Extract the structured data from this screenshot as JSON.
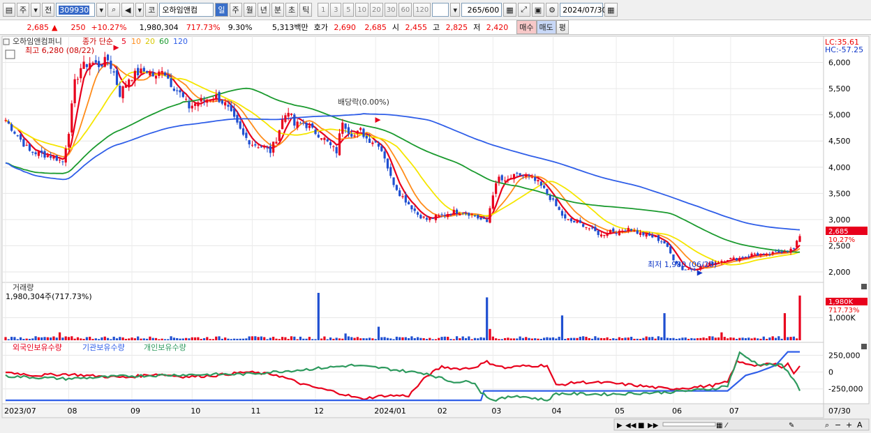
{
  "toolbar": {
    "type1": "주",
    "type2": "전",
    "code": "309930",
    "stock_name": "오하임앤컴",
    "periods": [
      "일",
      "주",
      "월",
      "년",
      "분",
      "초",
      "틱"
    ],
    "active_period": "일",
    "minutes": [
      "1",
      "3",
      "5",
      "10",
      "20",
      "30",
      "60",
      "120"
    ],
    "count": "265",
    "count_max": "/600",
    "date": "2024/07/30"
  },
  "quote": {
    "price": "2,685",
    "arrow": "▲",
    "change": "250",
    "change_pct": "+10.27%",
    "volume": "1,980,304",
    "volume_ratio": "717.73%",
    "turnover": "9.30%",
    "amount": "5,313백만",
    "bid_label": "호가",
    "ask": "2,690",
    "bid": "2,685",
    "open_label": "시",
    "open": "2,455",
    "high_label": "고",
    "high": "2,825",
    "low_label": "저",
    "low": "2,420",
    "buy_label": "매수",
    "sell_label": "매도",
    "flat_label": "평"
  },
  "price_panel": {
    "name": "오하임앤컴퍼니",
    "ma_label": "종가 단순",
    "ma_periods": [
      "5",
      "10",
      "20",
      "60",
      "120"
    ],
    "max_label": "최고 6,280 (08/22)",
    "min_label": "최저 1,980 (06/28)",
    "dividend_label": "배당락(0.00%)",
    "lc_label": "LC:35.61",
    "hc_label": "HC:-57.25",
    "current_price": "2,685",
    "current_pct": "10.27%"
  },
  "volume_panel": {
    "title": "거래량",
    "value_label": "1,980,304주(717.73%)",
    "current": "1,980K",
    "current_pct": "717.73%"
  },
  "holding_panel": {
    "legend": [
      "외국인보유수량",
      "기관보유수량",
      "개인보유수량"
    ]
  },
  "x_axis": {
    "months": [
      "2023/07",
      "08",
      "09",
      "10",
      "11",
      "12",
      "2024/01",
      "02",
      "03",
      "04",
      "05",
      "06",
      "07"
    ],
    "last_date": "07/30"
  },
  "colors": {
    "ma5": "#e8001c",
    "ma10": "#ff8c1a",
    "ma20": "#f5e600",
    "ma60": "#1a9a2e",
    "ma120": "#2f5ee8",
    "up": "#e8001c",
    "down": "#1f4fd1",
    "foreign": "#e8001c",
    "inst": "#2f5ee8",
    "indiv": "#2e9a5e"
  },
  "chart_data": [
    {
      "type": "line",
      "title": "오하임앤컴퍼니",
      "subtitle": "종가 단순",
      "ylim": [
        1800,
        6500
      ],
      "yticks": [
        2000,
        2500,
        3000,
        3500,
        4000,
        4500,
        5000,
        5500,
        6000
      ],
      "months": [
        {
          "label": "2023/07",
          "i": 0
        },
        {
          "label": "08",
          "i": 21
        },
        {
          "label": "09",
          "i": 42
        },
        {
          "label": "10",
          "i": 62
        },
        {
          "label": "11",
          "i": 82
        },
        {
          "label": "12",
          "i": 103
        },
        {
          "label": "2024/01",
          "i": 123
        },
        {
          "label": "02",
          "i": 144
        },
        {
          "label": "03",
          "i": 162
        },
        {
          "label": "04",
          "i": 182
        },
        {
          "label": "05",
          "i": 203
        },
        {
          "label": "06",
          "i": 222
        },
        {
          "label": "07",
          "i": 241
        }
      ],
      "close_anchors": [
        [
          0,
          4900
        ],
        [
          4,
          4600
        ],
        [
          8,
          4300
        ],
        [
          12,
          4250
        ],
        [
          16,
          4200
        ],
        [
          19,
          4100
        ],
        [
          21,
          4700
        ],
        [
          23,
          5600
        ],
        [
          25,
          5900
        ],
        [
          28,
          6000
        ],
        [
          31,
          5950
        ],
        [
          34,
          6050
        ],
        [
          36,
          5800
        ],
        [
          38,
          5400
        ],
        [
          41,
          5700
        ],
        [
          44,
          5800
        ],
        [
          47,
          5850
        ],
        [
          50,
          5700
        ],
        [
          52,
          5900
        ],
        [
          55,
          5600
        ],
        [
          58,
          5400
        ],
        [
          61,
          5150
        ],
        [
          64,
          5250
        ],
        [
          67,
          5300
        ],
        [
          70,
          5350
        ],
        [
          73,
          5200
        ],
        [
          76,
          4900
        ],
        [
          79,
          4600
        ],
        [
          82,
          4450
        ],
        [
          85,
          4400
        ],
        [
          88,
          4300
        ],
        [
          90,
          4550
        ],
        [
          92,
          4900
        ],
        [
          94,
          5100
        ],
        [
          96,
          4800
        ],
        [
          99,
          4850
        ],
        [
          102,
          4700
        ],
        [
          105,
          4600
        ],
        [
          108,
          4400
        ],
        [
          110,
          4300
        ],
        [
          112,
          4900
        ],
        [
          114,
          4700
        ],
        [
          116,
          4600
        ],
        [
          118,
          4700
        ],
        [
          120,
          4550
        ],
        [
          122,
          4500
        ],
        [
          124,
          4450
        ],
        [
          126,
          4200
        ],
        [
          128,
          3800
        ],
        [
          131,
          3500
        ],
        [
          134,
          3300
        ],
        [
          137,
          3100
        ],
        [
          140,
          3000
        ],
        [
          143,
          3050
        ],
        [
          146,
          3100
        ],
        [
          149,
          3150
        ],
        [
          152,
          3150
        ],
        [
          155,
          3100
        ],
        [
          158,
          3000
        ],
        [
          160,
          2950
        ],
        [
          162,
          3500
        ],
        [
          164,
          3800
        ],
        [
          166,
          3700
        ],
        [
          168,
          3800
        ],
        [
          171,
          3850
        ],
        [
          174,
          3800
        ],
        [
          177,
          3700
        ],
        [
          180,
          3500
        ],
        [
          183,
          3250
        ],
        [
          186,
          3000
        ],
        [
          189,
          2950
        ],
        [
          192,
          2900
        ],
        [
          195,
          2800
        ],
        [
          198,
          2700
        ],
        [
          201,
          2800
        ],
        [
          204,
          2750
        ],
        [
          207,
          2850
        ],
        [
          210,
          2750
        ],
        [
          213,
          2700
        ],
        [
          216,
          2650
        ],
        [
          219,
          2550
        ],
        [
          222,
          2250
        ],
        [
          225,
          2050
        ],
        [
          228,
          2050
        ],
        [
          231,
          2100
        ],
        [
          234,
          2150
        ],
        [
          237,
          2200
        ],
        [
          240,
          2250
        ],
        [
          243,
          2250
        ],
        [
          246,
          2300
        ],
        [
          249,
          2350
        ],
        [
          252,
          2300
        ],
        [
          255,
          2350
        ],
        [
          258,
          2400
        ],
        [
          262,
          2435
        ],
        [
          264,
          2685
        ]
      ],
      "series": [
        {
          "name": "5"
        },
        {
          "name": "10"
        },
        {
          "name": "20"
        },
        {
          "name": "60"
        },
        {
          "name": "120"
        }
      ],
      "markers": [
        {
          "label": "최고 6,280 (08/22)",
          "x": 37,
          "y": 6280
        },
        {
          "label": "최저 1,980 (06/28)",
          "x": 231,
          "y": 1980
        },
        {
          "label": "배당락(0.00%)",
          "x": 124,
          "y": 4900
        }
      ],
      "last_value": 2685
    },
    {
      "type": "bar",
      "title": "거래량",
      "ylim": [
        0,
        2100000
      ],
      "yticks": [
        1000000
      ],
      "ytick_labels": [
        "1,000K"
      ],
      "spikes": [
        [
          18,
          350000
        ],
        [
          104,
          2100000
        ],
        [
          113,
          300000
        ],
        [
          124,
          600000
        ],
        [
          160,
          1900000
        ],
        [
          161,
          500000
        ],
        [
          185,
          1100000
        ],
        [
          219,
          1200000
        ],
        [
          238,
          350000
        ],
        [
          259,
          1200000
        ],
        [
          264,
          1980304
        ]
      ],
      "base": 150000
    },
    {
      "type": "line",
      "title": "보유수량",
      "ylim": [
        -450000,
        400000
      ],
      "yticks": [
        250000,
        0,
        -250000
      ],
      "ytick_labels": [
        "250,000",
        "0",
        "-250,000"
      ],
      "series": [
        {
          "name": "외국인보유수량",
          "anchors": [
            [
              0,
              0
            ],
            [
              10,
              -50000
            ],
            [
              20,
              -30000
            ],
            [
              30,
              -60000
            ],
            [
              40,
              -80000
            ],
            [
              50,
              -30000
            ],
            [
              60,
              -70000
            ],
            [
              70,
              -50000
            ],
            [
              80,
              0
            ],
            [
              90,
              -40000
            ],
            [
              100,
              -200000
            ],
            [
              110,
              -300000
            ],
            [
              118,
              -400000
            ],
            [
              126,
              -350000
            ],
            [
              134,
              -350000
            ],
            [
              140,
              -60000
            ],
            [
              145,
              80000
            ],
            [
              150,
              50000
            ],
            [
              155,
              60000
            ],
            [
              160,
              150000
            ],
            [
              166,
              60000
            ],
            [
              172,
              90000
            ],
            [
              180,
              100000
            ],
            [
              183,
              -200000
            ],
            [
              190,
              -150000
            ],
            [
              200,
              -160000
            ],
            [
              210,
              -200000
            ],
            [
              220,
              -250000
            ],
            [
              228,
              -230000
            ],
            [
              235,
              -200000
            ],
            [
              240,
              -150000
            ],
            [
              243,
              150000
            ],
            [
              250,
              100000
            ],
            [
              256,
              120000
            ],
            [
              258,
              50000
            ],
            [
              260,
              150000
            ],
            [
              262,
              -30000
            ],
            [
              264,
              100000
            ]
          ]
        },
        {
          "name": "기관보유수량",
          "anchors": [
            [
              0,
              -420000
            ],
            [
              150,
              -420000
            ],
            [
              158,
              -420000
            ],
            [
              159,
              -280000
            ],
            [
              200,
              -280000
            ],
            [
              240,
              -280000
            ],
            [
              246,
              -50000
            ],
            [
              250,
              0
            ],
            [
              256,
              100000
            ],
            [
              260,
              300000
            ],
            [
              264,
              300000
            ]
          ]
        },
        {
          "name": "개인보유수량",
          "anchors": [
            [
              0,
              -60000
            ],
            [
              20,
              -100000
            ],
            [
              40,
              -60000
            ],
            [
              60,
              -40000
            ],
            [
              80,
              -30000
            ],
            [
              100,
              40000
            ],
            [
              115,
              100000
            ],
            [
              125,
              60000
            ],
            [
              135,
              0
            ],
            [
              140,
              -20000
            ],
            [
              148,
              -140000
            ],
            [
              156,
              -150000
            ],
            [
              158,
              -300000
            ],
            [
              162,
              -420000
            ],
            [
              170,
              -350000
            ],
            [
              180,
              -420000
            ],
            [
              183,
              -320000
            ],
            [
              200,
              -330000
            ],
            [
              220,
              -300000
            ],
            [
              235,
              -250000
            ],
            [
              240,
              -200000
            ],
            [
              244,
              280000
            ],
            [
              250,
              120000
            ],
            [
              258,
              100000
            ],
            [
              262,
              -100000
            ],
            [
              264,
              -280000
            ]
          ]
        }
      ]
    }
  ]
}
